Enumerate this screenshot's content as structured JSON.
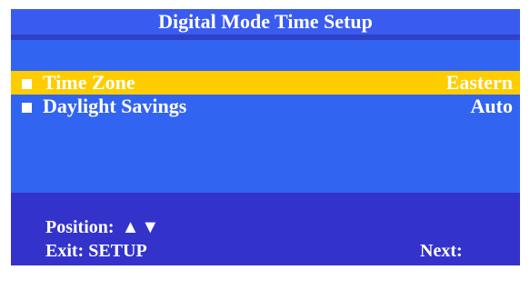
{
  "header": {
    "title": "Digital Mode Time Setup"
  },
  "menu": {
    "items": [
      {
        "label": "Time Zone",
        "value": "Eastern",
        "selected": true,
        "bullet_icon": "square-bullet-icon"
      },
      {
        "label": "Daylight Savings",
        "value": "Auto",
        "selected": false,
        "bullet_icon": "square-bullet-icon"
      }
    ]
  },
  "footer": {
    "position_label": "Position:",
    "position_icon": "up-down-arrows-icon",
    "position_glyphs": "▲▼",
    "exit_label": "Exit: SETUP",
    "next_label": "Next:"
  },
  "colors": {
    "title_bg": "#3a5bf0",
    "menu_bg": "#3264f2",
    "footer_bg": "#3333cc",
    "highlight": "#ffcc00",
    "text": "#ffffff"
  }
}
